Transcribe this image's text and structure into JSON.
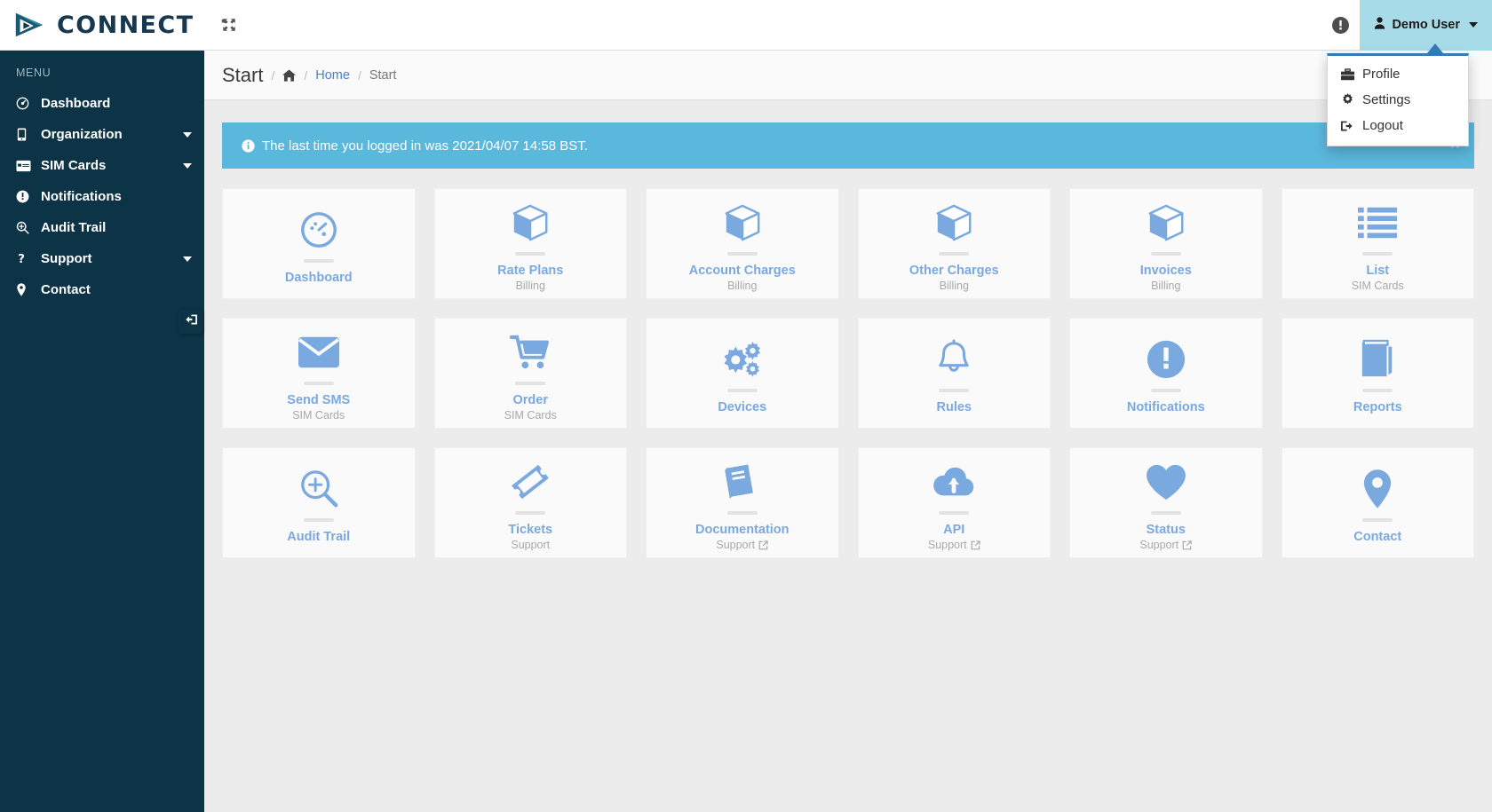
{
  "header": {
    "brand_name": "CONNECT",
    "brand_logo_icon": "play-triangle-logo",
    "fullscreen_icon": "compress-arrows-icon",
    "alert_icon": "exclamation-circle-icon",
    "user_icon": "user-icon",
    "user_name": "Demo User",
    "caret_icon": "caret-down-icon",
    "user_btn_color": "#a8dbe8"
  },
  "user_dropdown": {
    "visible": true,
    "items": [
      {
        "label": "Profile",
        "icon": "briefcase-icon"
      },
      {
        "label": "Settings",
        "icon": "gear-icon"
      },
      {
        "label": "Logout",
        "icon": "sign-out-icon"
      }
    ]
  },
  "sidebar": {
    "menu_label": "MENU",
    "background": "#0c3346",
    "collapse_icon": "sign-in-arrow-icon",
    "items": [
      {
        "label": "Dashboard",
        "icon": "tachometer-icon",
        "caret": false
      },
      {
        "label": "Organization",
        "icon": "mobile-icon",
        "caret": true
      },
      {
        "label": "SIM Cards",
        "icon": "sim-card-icon",
        "caret": true
      },
      {
        "label": "Notifications",
        "icon": "exclamation-circle-icon",
        "caret": false
      },
      {
        "label": "Audit Trail",
        "icon": "search-plus-icon",
        "caret": false
      },
      {
        "label": "Support",
        "icon": "question-icon",
        "caret": true
      },
      {
        "label": "Contact",
        "icon": "map-marker-icon",
        "caret": false
      }
    ]
  },
  "breadcrumb": {
    "page_title": "Start",
    "home_icon": "home-icon",
    "separator": "/",
    "link_label": "Home",
    "current_label": "Start"
  },
  "alert": {
    "icon": "info-circle-icon",
    "message": "The last time you logged in was 2021/04/07 14:58 BST.",
    "close_label": "×",
    "color": "#5bb8dd"
  },
  "tiles": [
    {
      "title": "Dashboard",
      "subtitle": "",
      "icon": "tachometer-circle-icon",
      "external": false
    },
    {
      "title": "Rate Plans",
      "subtitle": "Billing",
      "icon": "cube-icon",
      "external": false
    },
    {
      "title": "Account Charges",
      "subtitle": "Billing",
      "icon": "cube-icon",
      "external": false
    },
    {
      "title": "Other Charges",
      "subtitle": "Billing",
      "icon": "cube-icon",
      "external": false
    },
    {
      "title": "Invoices",
      "subtitle": "Billing",
      "icon": "cube-icon",
      "external": false
    },
    {
      "title": "List",
      "subtitle": "SIM Cards",
      "icon": "list-icon",
      "external": false
    },
    {
      "title": "Send SMS",
      "subtitle": "SIM Cards",
      "icon": "envelope-icon",
      "external": false
    },
    {
      "title": "Order",
      "subtitle": "SIM Cards",
      "icon": "shopping-cart-icon",
      "external": false
    },
    {
      "title": "Devices",
      "subtitle": "",
      "icon": "cogs-icon",
      "external": false
    },
    {
      "title": "Rules",
      "subtitle": "",
      "icon": "bell-icon",
      "external": false
    },
    {
      "title": "Notifications",
      "subtitle": "",
      "icon": "exclamation-circle-icon",
      "external": false
    },
    {
      "title": "Reports",
      "subtitle": "",
      "icon": "book-icon",
      "external": false
    },
    {
      "title": "Audit Trail",
      "subtitle": "",
      "icon": "search-plus-icon",
      "external": false
    },
    {
      "title": "Tickets",
      "subtitle": "Support",
      "icon": "ticket-icon",
      "external": false
    },
    {
      "title": "Documentation",
      "subtitle": "Support",
      "icon": "book-icon",
      "external": true
    },
    {
      "title": "API",
      "subtitle": "Support",
      "icon": "cloud-upload-icon",
      "external": true
    },
    {
      "title": "Status",
      "subtitle": "Support",
      "icon": "heart-icon",
      "external": true
    },
    {
      "title": "Contact",
      "subtitle": "",
      "icon": "map-marker-icon",
      "external": false
    }
  ],
  "theme": {
    "accent_blue": "#7aa9e0",
    "sidebar_dark": "#0c3346",
    "page_bg": "#ececec"
  }
}
